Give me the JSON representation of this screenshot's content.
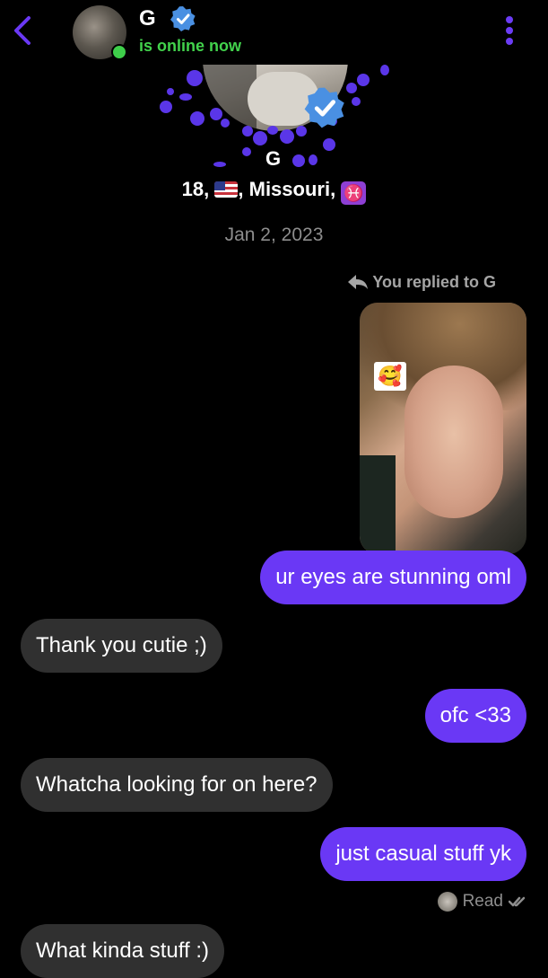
{
  "header": {
    "name": "G",
    "status": "is online now",
    "status_color": "#42d24c"
  },
  "profile": {
    "name": "G",
    "age": "18,",
    "location": ", Missouri,",
    "zodiac": "♓"
  },
  "chat": {
    "date": "Jan 2, 2023",
    "reply_label": "You replied to G",
    "sticker": "🥰",
    "messages": [
      {
        "from": "me",
        "text": "ur eyes are stunning oml"
      },
      {
        "from": "them",
        "text": "Thank you cutie ;)"
      },
      {
        "from": "me",
        "text": "ofc <33"
      },
      {
        "from": "them",
        "text": "Whatcha looking for on here?"
      },
      {
        "from": "me",
        "text": "just casual stuff yk"
      },
      {
        "from": "them",
        "text": "What kinda stuff :)"
      }
    ],
    "read_label": "Read"
  },
  "colors": {
    "accent": "#6a38f5",
    "incoming_bubble": "#303030",
    "verified": "#4a90e2"
  },
  "icons": [
    "back-icon",
    "verified-icon",
    "more-options-icon",
    "reply-arrow-icon",
    "read-check-icon",
    "us-flag-icon",
    "pisces-icon"
  ]
}
